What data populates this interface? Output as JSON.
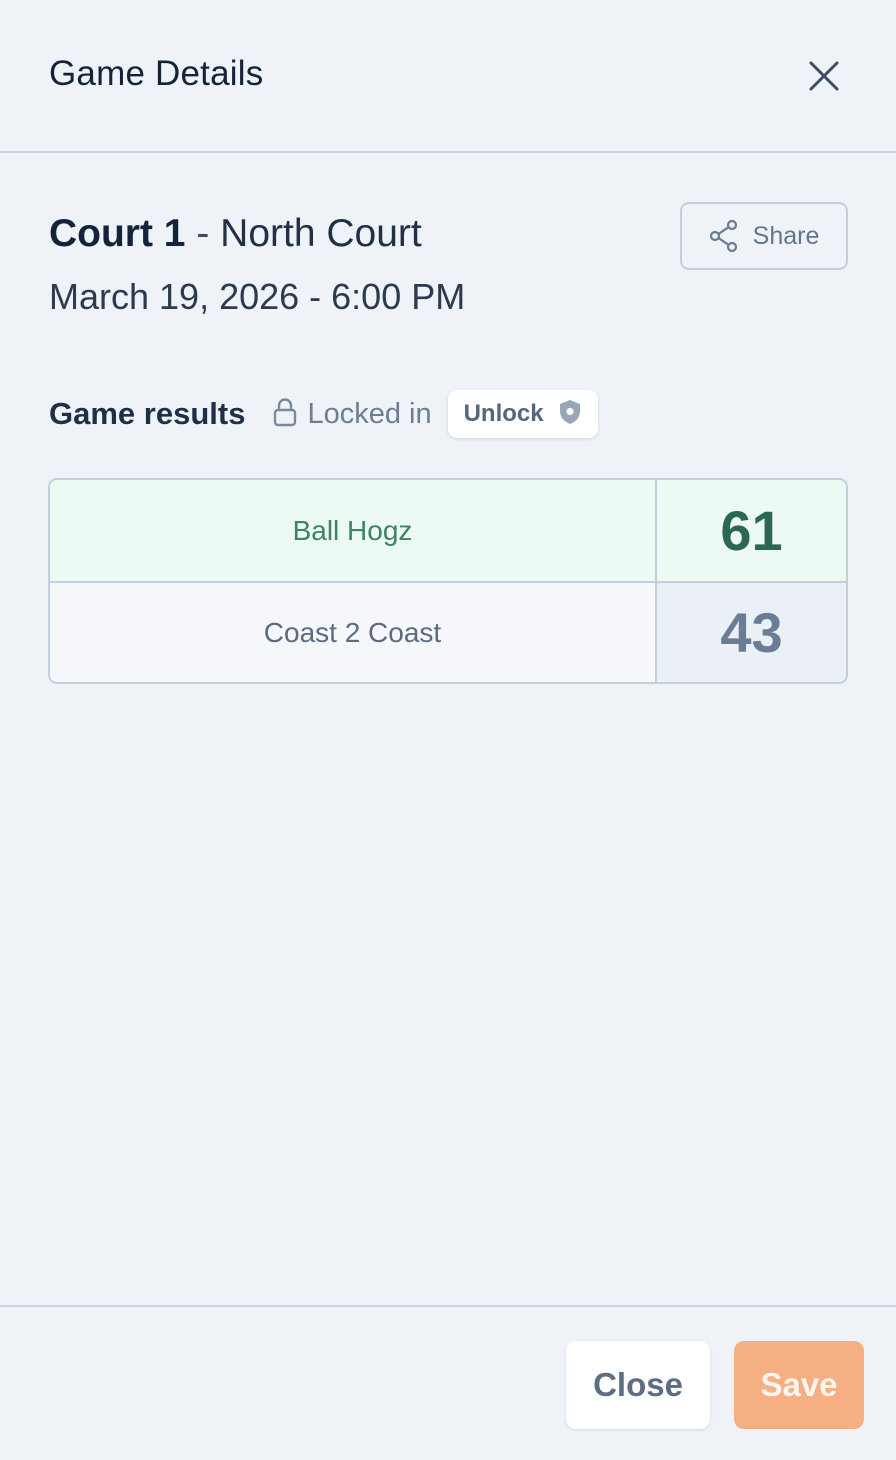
{
  "header": {
    "title": "Game Details"
  },
  "game": {
    "court_name": "Court 1",
    "separator": " - ",
    "court_place": "North Court",
    "datetime": "March 19, 2026 - 6:00 PM"
  },
  "share": {
    "label": "Share",
    "icon": "share-icon"
  },
  "results": {
    "title": "Game results",
    "status": "Locked in",
    "status_icon": "lock-icon",
    "unlock_label": "Unlock",
    "unlock_icon": "shield-icon",
    "rows": [
      {
        "team": "Ball Hogz",
        "score": "61",
        "winner": true
      },
      {
        "team": "Coast 2 Coast",
        "score": "43",
        "winner": false
      }
    ]
  },
  "footer": {
    "close_label": "Close",
    "save_label": "Save"
  },
  "colors": {
    "accent_save": "#f6ae83",
    "winner_text": "#2c6753",
    "winner_bg": "#ecfaf3"
  }
}
